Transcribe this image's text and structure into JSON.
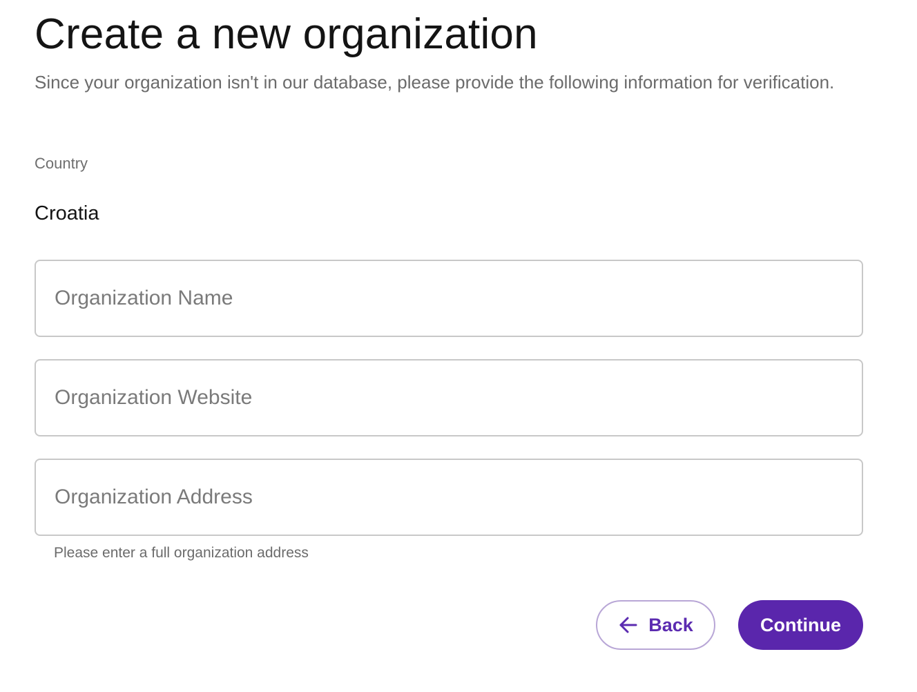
{
  "header": {
    "title": "Create a new organization",
    "subtitle": "Since your organization isn't in our database, please provide the following information for verification."
  },
  "country": {
    "label": "Country",
    "value": "Croatia"
  },
  "form": {
    "name_placeholder": "Organization Name",
    "website_placeholder": "Organization Website",
    "address_placeholder": "Organization Address",
    "address_helper": "Please enter a full organization address"
  },
  "actions": {
    "back_label": "Back",
    "continue_label": "Continue"
  },
  "icons": {
    "back": "arrow-left-icon"
  },
  "colors": {
    "accent": "#5a26ac",
    "accent_border": "#b8a6d6",
    "input_border": "#c8c8c8",
    "muted_text": "#6b6b6b"
  }
}
